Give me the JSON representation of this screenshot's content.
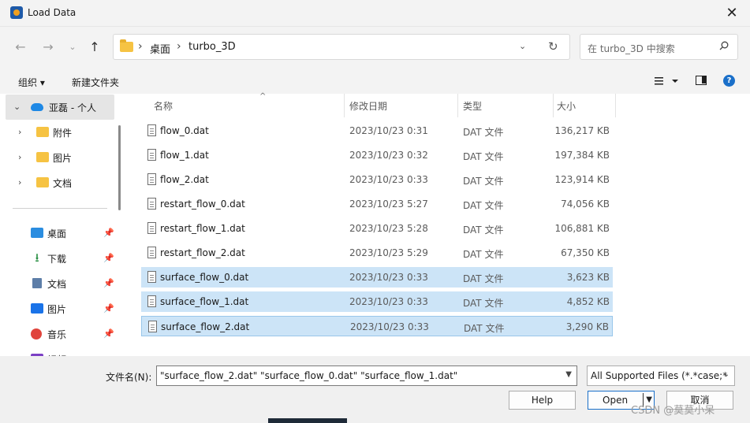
{
  "window": {
    "title": "Load Data"
  },
  "address": {
    "crumbs": [
      "桌面",
      "turbo_3D"
    ]
  },
  "search": {
    "placeholder": "在 turbo_3D 中搜索"
  },
  "toolbar": {
    "organize": "组织",
    "new_folder": "新建文件夹",
    "help_glyph": "?"
  },
  "sidebar": {
    "top": [
      {
        "label": "亚磊 - 个人",
        "icon": "cloud-icon",
        "selected": true,
        "chev": "⌄"
      },
      {
        "label": "附件",
        "icon": "folder-icon",
        "chev": "›"
      },
      {
        "label": "图片",
        "icon": "folder-icon",
        "chev": "›"
      },
      {
        "label": "文档",
        "icon": "folder-icon",
        "chev": "›"
      }
    ],
    "quick": [
      {
        "label": "桌面",
        "icon": "desktop-icon"
      },
      {
        "label": "下载",
        "icon": "download-icon"
      },
      {
        "label": "文档",
        "icon": "document-icon"
      },
      {
        "label": "图片",
        "icon": "picture-icon"
      },
      {
        "label": "音乐",
        "icon": "music-icon"
      },
      {
        "label": "视频",
        "icon": "video-icon"
      }
    ]
  },
  "columns": {
    "name": "名称",
    "date": "修改日期",
    "type": "类型",
    "size": "大小"
  },
  "files": [
    {
      "name": "flow_0.dat",
      "date": "2023/10/23 0:31",
      "type": "DAT 文件",
      "size": "136,217 KB",
      "selected": false
    },
    {
      "name": "flow_1.dat",
      "date": "2023/10/23 0:32",
      "type": "DAT 文件",
      "size": "197,384 KB",
      "selected": false
    },
    {
      "name": "flow_2.dat",
      "date": "2023/10/23 0:33",
      "type": "DAT 文件",
      "size": "123,914 KB",
      "selected": false
    },
    {
      "name": "restart_flow_0.dat",
      "date": "2023/10/23 5:27",
      "type": "DAT 文件",
      "size": "74,056 KB",
      "selected": false
    },
    {
      "name": "restart_flow_1.dat",
      "date": "2023/10/23 5:28",
      "type": "DAT 文件",
      "size": "106,881 KB",
      "selected": false
    },
    {
      "name": "restart_flow_2.dat",
      "date": "2023/10/23 5:29",
      "type": "DAT 文件",
      "size": "67,350 KB",
      "selected": false
    },
    {
      "name": "surface_flow_0.dat",
      "date": "2023/10/23 0:33",
      "type": "DAT 文件",
      "size": "3,623 KB",
      "selected": true
    },
    {
      "name": "surface_flow_1.dat",
      "date": "2023/10/23 0:33",
      "type": "DAT 文件",
      "size": "4,852 KB",
      "selected": true
    },
    {
      "name": "surface_flow_2.dat",
      "date": "2023/10/23 0:33",
      "type": "DAT 文件",
      "size": "3,290 KB",
      "selected": true,
      "focused": true
    }
  ],
  "footer": {
    "filename_label": "文件名(N):",
    "filename_value": "\"surface_flow_2.dat\" \"surface_flow_0.dat\" \"surface_flow_1.dat\"",
    "filetype_value": "All Supported Files (*.*case;*",
    "help_label": "Help",
    "open_label": "Open",
    "cancel_label": "取消",
    "watermark": "CSDN @莫莫小呆"
  },
  "colors": {
    "selection": "#cce4f7",
    "accent": "#1a6fc9"
  }
}
